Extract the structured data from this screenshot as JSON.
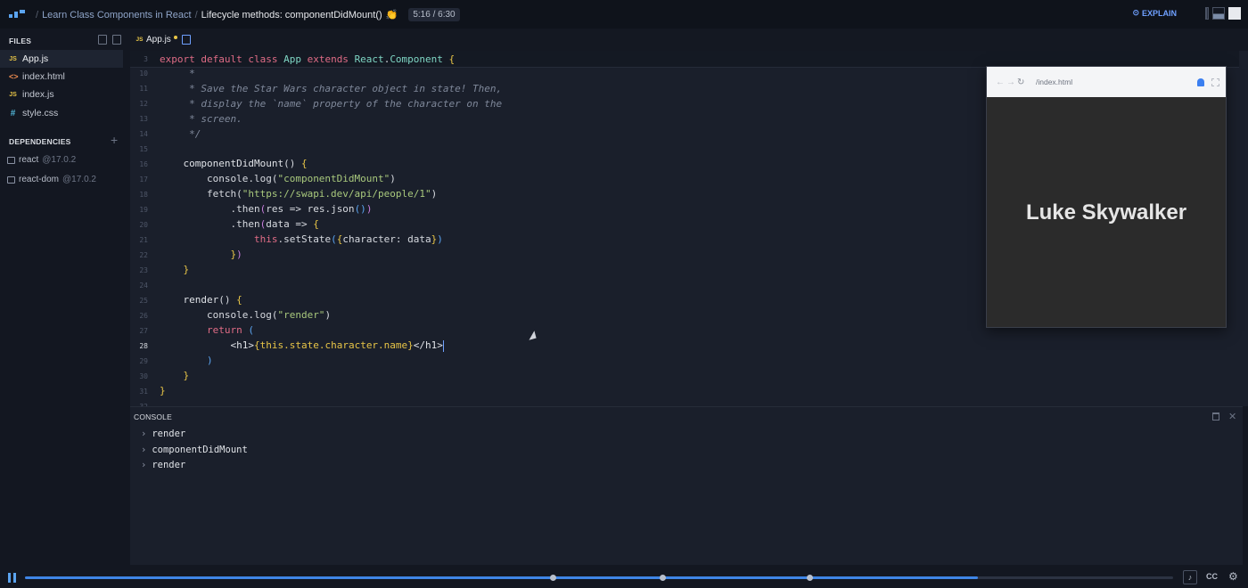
{
  "topbar": {
    "breadcrumb": [
      "Learn Class Components in React",
      "Lifecycle methods: componentDidMount()"
    ],
    "emoji": "👏",
    "time": "5:16 / 6:30",
    "explain_label": "EXPLAIN"
  },
  "sidebar": {
    "files_header": "FILES",
    "files": [
      {
        "label": "App.js",
        "icon": "js-file-icon",
        "badge": "JS",
        "active": true
      },
      {
        "label": "index.html",
        "icon": "html-file-icon",
        "badge": "<>"
      },
      {
        "label": "index.js",
        "icon": "js-file-icon",
        "badge": "JS"
      },
      {
        "label": "style.css",
        "icon": "css-file-icon",
        "badge": "#"
      }
    ],
    "deps_header": "DEPENDENCIES",
    "deps": [
      {
        "name": "react",
        "version": "@17.0.2"
      },
      {
        "name": "react-dom",
        "version": "@17.0.2"
      }
    ]
  },
  "editor": {
    "tab": "App.js",
    "tab_badge": "JS",
    "sticky_line_number": "3",
    "lines": [
      {
        "n": "10",
        "code": "     *"
      },
      {
        "n": "11",
        "code": "     * Save the Star Wars character object in state! Then,"
      },
      {
        "n": "12",
        "code": "     * display the `name` property of the character on the"
      },
      {
        "n": "13",
        "code": "     * screen."
      },
      {
        "n": "14",
        "code": "     */"
      },
      {
        "n": "15",
        "code": ""
      },
      {
        "n": "16",
        "code": "    componentDidMount() {"
      },
      {
        "n": "17",
        "code": "        console.log(\"componentDidMount\")"
      },
      {
        "n": "18",
        "code": "        fetch(\"https://swapi.dev/api/people/1\")"
      },
      {
        "n": "19",
        "code": "            .then(res => res.json())"
      },
      {
        "n": "20",
        "code": "            .then(data => {"
      },
      {
        "n": "21",
        "code": "                this.setState({character: data})"
      },
      {
        "n": "22",
        "code": "            })"
      },
      {
        "n": "23",
        "code": "    }"
      },
      {
        "n": "24",
        "code": ""
      },
      {
        "n": "25",
        "code": "    render() {"
      },
      {
        "n": "26",
        "code": "        console.log(\"render\")"
      },
      {
        "n": "27",
        "code": "        return ("
      },
      {
        "n": "28",
        "code": "            <h1>{this.state.character.name}</h1>"
      },
      {
        "n": "29",
        "code": "        )"
      },
      {
        "n": "30",
        "code": "    }"
      },
      {
        "n": "31",
        "code": "}"
      },
      {
        "n": "32",
        "code": ""
      }
    ],
    "sticky_code": "export default class App extends React.Component {"
  },
  "preview": {
    "url": "/index.html",
    "heading": "Luke Skywalker"
  },
  "console": {
    "title": "CONSOLE",
    "logs": [
      "render",
      "componentDidMount",
      "render"
    ]
  },
  "player": {
    "progress": 0.83,
    "markers": [
      0.46,
      0.555,
      0.683
    ],
    "cc_label": "CC"
  },
  "colors": {
    "accent": "#3f85e6",
    "keyword": "#e06c86",
    "class": "#7fd6c4",
    "string": "#a9c97d"
  }
}
